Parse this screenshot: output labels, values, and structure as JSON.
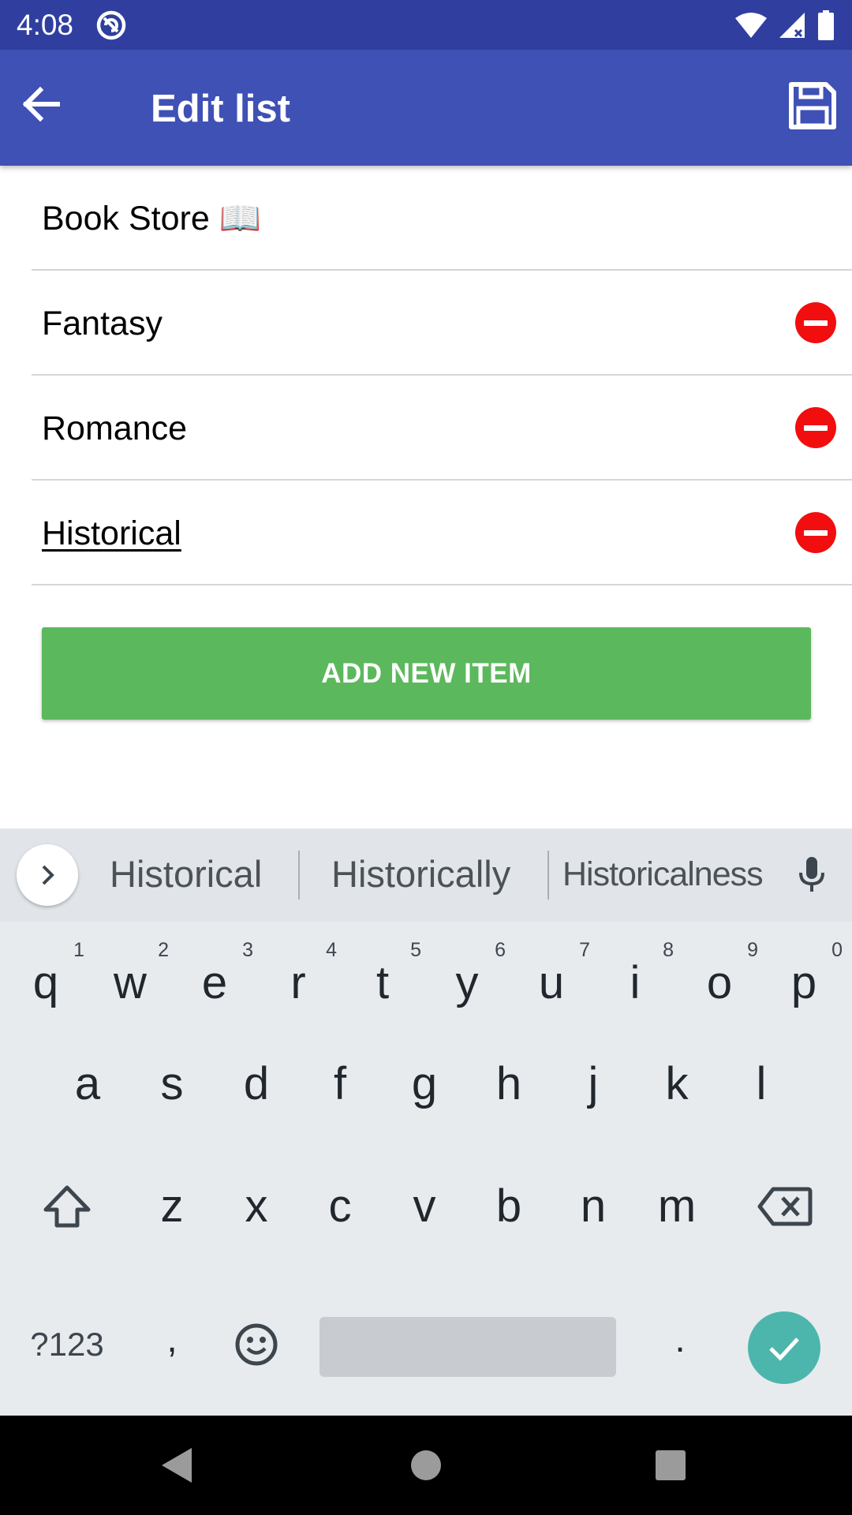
{
  "status_bar": {
    "time": "4:08"
  },
  "app_bar": {
    "title": "Edit list"
  },
  "list": {
    "name": "Book Store 📖",
    "items": [
      {
        "label": "Fantasy"
      },
      {
        "label": "Romance"
      },
      {
        "label": "Historical"
      }
    ],
    "add_button_label": "ADD NEW ITEM"
  },
  "keyboard": {
    "suggestions": [
      "Historical",
      "Historically",
      "Historicalness"
    ],
    "row1": [
      {
        "key": "q",
        "hint": "1"
      },
      {
        "key": "w",
        "hint": "2"
      },
      {
        "key": "e",
        "hint": "3"
      },
      {
        "key": "r",
        "hint": "4"
      },
      {
        "key": "t",
        "hint": "5"
      },
      {
        "key": "y",
        "hint": "6"
      },
      {
        "key": "u",
        "hint": "7"
      },
      {
        "key": "i",
        "hint": "8"
      },
      {
        "key": "o",
        "hint": "9"
      },
      {
        "key": "p",
        "hint": "0"
      }
    ],
    "row2": [
      "a",
      "s",
      "d",
      "f",
      "g",
      "h",
      "j",
      "k",
      "l"
    ],
    "row3": [
      "z",
      "x",
      "c",
      "v",
      "b",
      "n",
      "m"
    ],
    "symbols_label": "?123",
    "comma": ",",
    "period": "."
  },
  "colors": {
    "status_bar": "#303f9f",
    "app_bar": "#3f51b5",
    "remove": "#f20e0e",
    "add_button": "#5cb85c",
    "enter_key": "#4db6ac"
  },
  "icons": [
    "app-notification-icon",
    "wifi-icon",
    "signal-icon",
    "battery-icon",
    "back-arrow-icon",
    "save-icon",
    "remove-icon",
    "chevron-right-icon",
    "mic-icon",
    "shift-icon",
    "backspace-icon",
    "emoji-icon",
    "check-icon",
    "nav-back-icon",
    "nav-home-icon",
    "nav-recents-icon"
  ]
}
